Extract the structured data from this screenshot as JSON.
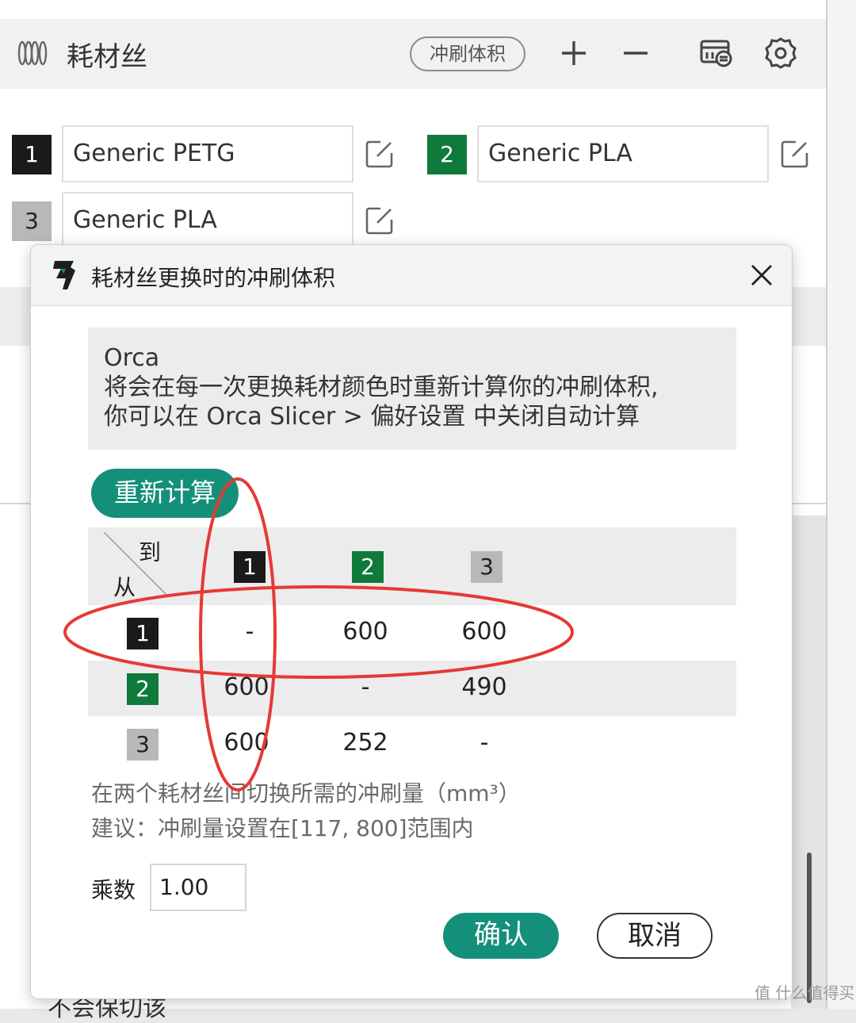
{
  "colors": {
    "slot1": "#1a1a1a",
    "slot2": "#0f7a3c",
    "slot3": "#b8b8b8",
    "accent": "#14907a",
    "annotation": "#e53935"
  },
  "header": {
    "title": "耗材丝",
    "flush_button": "冲刷体积",
    "icons": [
      "spool-icon",
      "plus-icon",
      "minus-icon",
      "ams-icon",
      "gear-icon"
    ]
  },
  "slots": [
    {
      "number": "1",
      "name": "Generic PETG"
    },
    {
      "number": "2",
      "name": "Generic PLA"
    },
    {
      "number": "3",
      "name": "Generic PLA"
    }
  ],
  "background": {
    "bottom_text": "不会保切该"
  },
  "dialog": {
    "title": "耗材丝更换时的冲刷体积",
    "info_lines": [
      "Orca",
      "将会在每一次更换耗材颜色时重新计算你的冲刷体积,",
      "你可以在 Orca Slicer > 偏好设置 中关闭自动计算"
    ],
    "recalc_button": "重新计算",
    "matrix": {
      "to_label": "到",
      "from_label": "从",
      "columns": [
        "1",
        "2",
        "3"
      ],
      "rows": [
        {
          "from": "1",
          "cells": [
            "-",
            "600",
            "600"
          ]
        },
        {
          "from": "2",
          "cells": [
            "600",
            "-",
            "490"
          ]
        },
        {
          "from": "3",
          "cells": [
            "600",
            "252",
            "-"
          ]
        }
      ]
    },
    "note": "在两个耗材丝间切换所需的冲刷量（mm³）",
    "suggestion": "建议：冲刷量设置在[117, 800]范围内",
    "multiplier_label": "乘数",
    "multiplier_value": "1.00",
    "confirm_button": "确认",
    "cancel_button": "取消"
  },
  "watermark": "值 什么值得买"
}
